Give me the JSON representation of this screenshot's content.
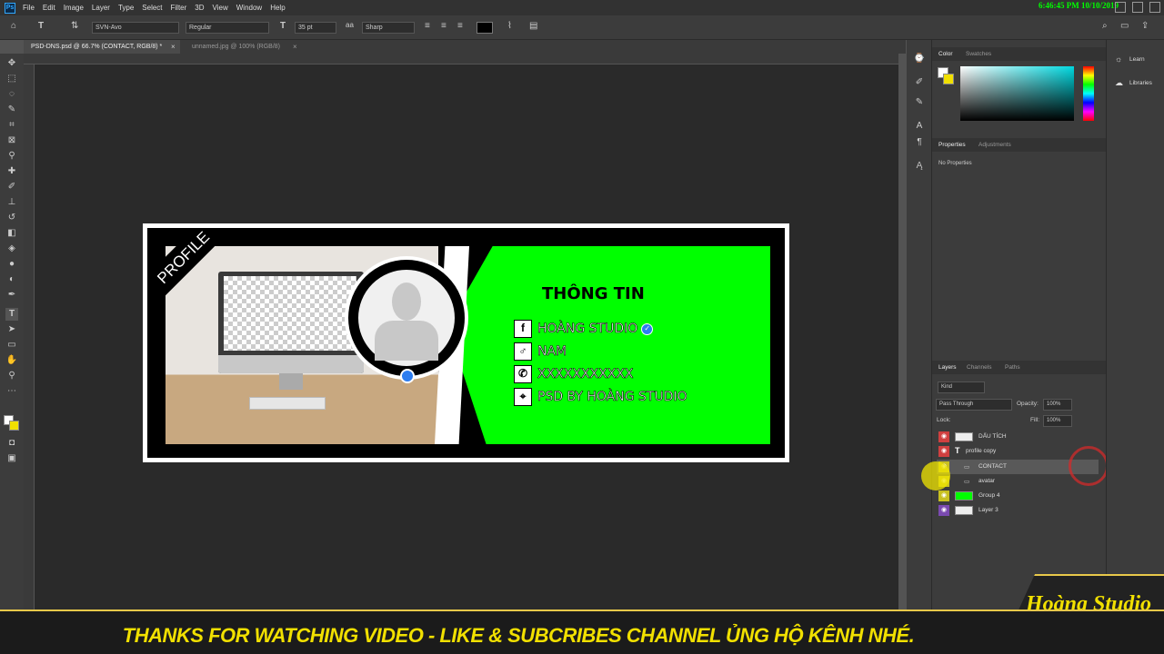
{
  "menu": {
    "app_icon": "Ps",
    "items": [
      "File",
      "Edit",
      "Image",
      "Layer",
      "Type",
      "Select",
      "Filter",
      "3D",
      "View",
      "Window",
      "Help"
    ],
    "clock": "6:46:45 PM 10/10/2019"
  },
  "options": {
    "font_family": "SVN-Avo",
    "font_style": "Regular",
    "font_size": "35 pt",
    "anti_alias": "Sharp",
    "text_color": "#000000"
  },
  "tabs": [
    {
      "label": "PSD-DNS.psd @ 66.7% (CONTACT, RGB/8) *"
    },
    {
      "label": "unnamed.jpg @ 100% (RGB/8)"
    }
  ],
  "banner": {
    "ribbon": "PROFILE",
    "title": "THÔNG TIN",
    "rows": [
      {
        "icon": "facebook-icon",
        "glyph": "f",
        "text": "HOÀNG STUDIO"
      },
      {
        "icon": "male-icon",
        "glyph": "♂",
        "text": "NAM"
      },
      {
        "icon": "phone-icon",
        "glyph": "✆",
        "text": "XXXXXXXXXXX"
      },
      {
        "icon": "location-icon",
        "glyph": "⌖",
        "text": "PSD BY HOÀNG STUDIO"
      }
    ],
    "accent": "#00ff00"
  },
  "panels": {
    "color_tabs": [
      "Color",
      "Swatches"
    ],
    "props_tabs": [
      "Properties",
      "Adjustments"
    ],
    "no_props": "No Properties",
    "layer_tabs": [
      "Layers",
      "Channels",
      "Paths"
    ],
    "kind": "Kind",
    "blend": "Pass Through",
    "opacity_label": "Opacity:",
    "opacity": "100%",
    "lock_label": "Lock:",
    "fill_label": "Fill:",
    "fill": "100%",
    "layers": [
      {
        "name": "DẤU TÍCH",
        "eye": "#d04040"
      },
      {
        "name": "profile copy",
        "eye": "#d04040"
      },
      {
        "name": "CONTACT",
        "eye": "#c8c020"
      },
      {
        "name": "avatar",
        "eye": "#c8c020"
      },
      {
        "name": "Group 4",
        "eye": "#c8c020"
      },
      {
        "name": "Layer 3",
        "eye": "#7a4ab0"
      }
    ]
  },
  "learn": {
    "items": [
      "Learn",
      "Libraries"
    ]
  },
  "footer": {
    "message": "THANKS FOR WATCHING VIDEO - LIKE & SUBCRIBES CHANNEL ỦNG HỘ KÊNH NHÉ.",
    "brand": "Hoàng Studio"
  }
}
